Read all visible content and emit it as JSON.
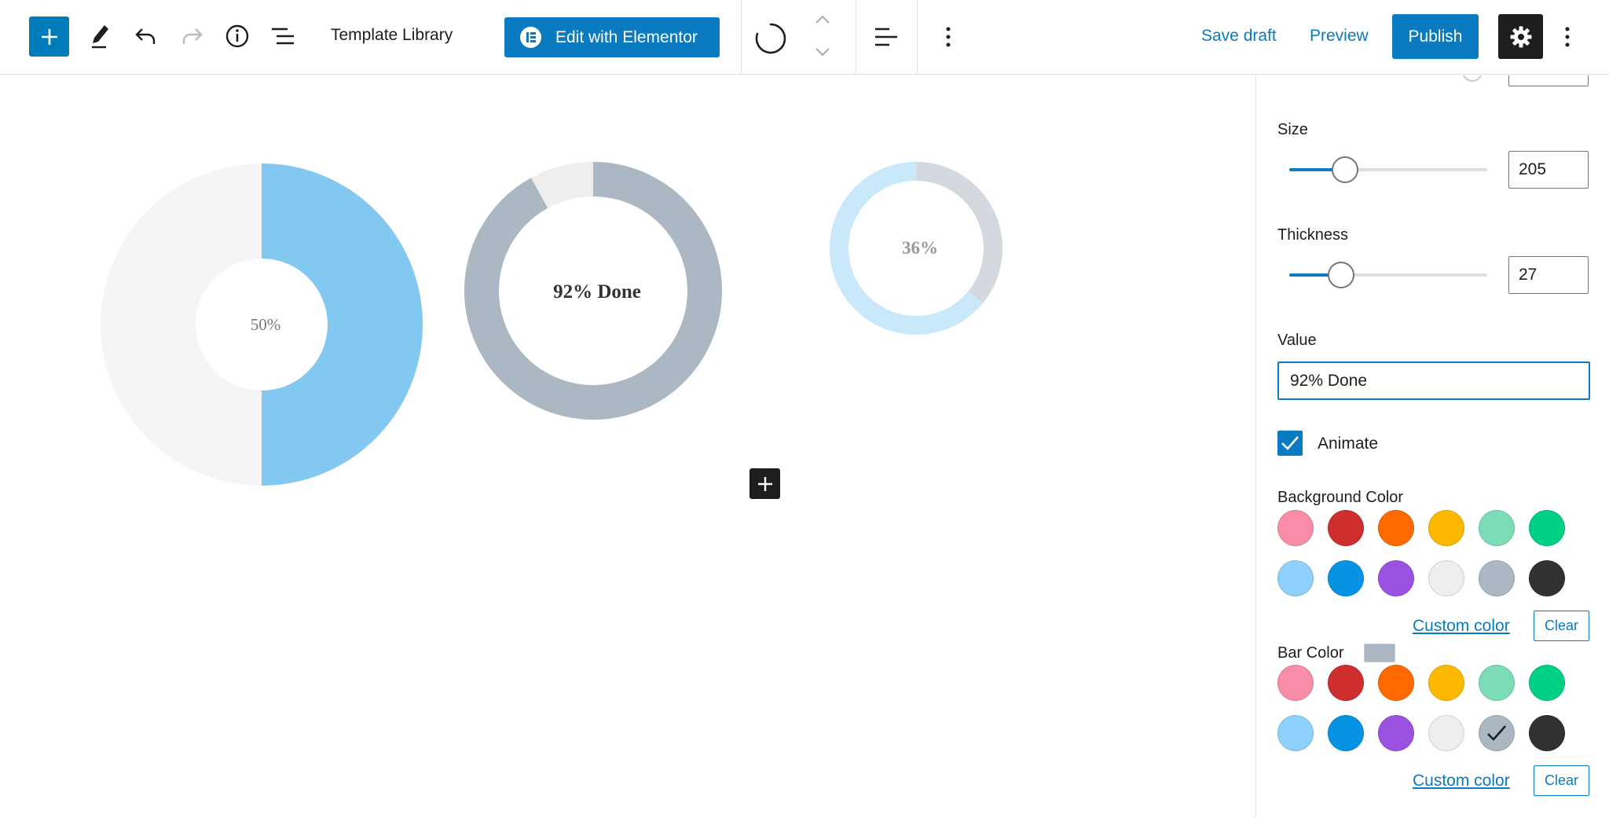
{
  "toolbar": {
    "document_title": "Template Library",
    "elementor_label": "Edit with Elementor",
    "save_draft_label": "Save draft",
    "preview_label": "Preview",
    "publish_label": "Publish"
  },
  "canvas": {
    "charts": [
      {
        "label": "50%",
        "percent": 50,
        "bar_color": "#82C8F0",
        "track_color": "#F5F5F5"
      },
      {
        "label": "92% Done",
        "percent": 92,
        "bar_color": "#ABB8C3",
        "track_color": "#EEEEEE"
      },
      {
        "label": "36%",
        "percent": 36,
        "bar_color": "#D4D9DF",
        "track_color": "#C9E8FA"
      }
    ]
  },
  "sidebar": {
    "size": {
      "label": "Size",
      "value": "205",
      "slider_fraction": 0.28
    },
    "thickness": {
      "label": "Thickness",
      "value": "27",
      "slider_fraction": 0.26
    },
    "value_field": {
      "label": "Value",
      "value": "92% Done"
    },
    "animate": {
      "label": "Animate",
      "checked": true
    },
    "background_color": {
      "label": "Background Color",
      "custom_color_label": "Custom color",
      "clear_label": "Clear",
      "swatches": [
        "#F78DA7",
        "#CF2E2E",
        "#FF6900",
        "#FCB900",
        "#7BDCB5",
        "#00D084",
        "#8ED1FC",
        "#0693E3",
        "#9B51E0",
        "#EEEEEE",
        "#ABB8C3",
        "#313131"
      ]
    },
    "bar_color": {
      "label": "Bar Color",
      "current": "#ABB8C3",
      "custom_color_label": "Custom color",
      "clear_label": "Clear",
      "selected_index": 10,
      "swatches": [
        "#F78DA7",
        "#CF2E2E",
        "#FF6900",
        "#FCB900",
        "#7BDCB5",
        "#00D084",
        "#8ED1FC",
        "#0693E3",
        "#9B51E0",
        "#EEEEEE",
        "#ABB8C3",
        "#313131"
      ]
    }
  }
}
